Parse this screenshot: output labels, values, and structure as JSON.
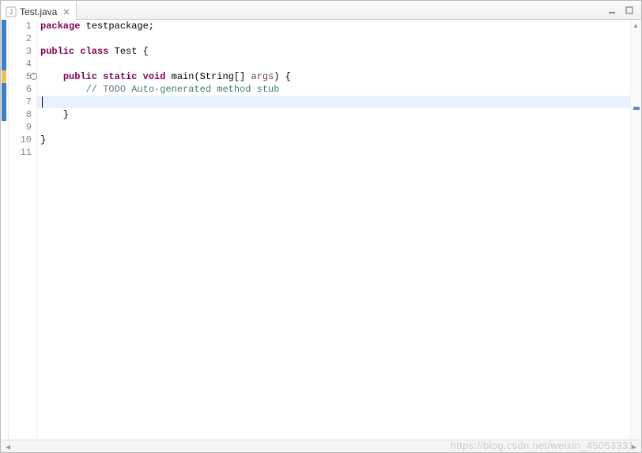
{
  "tab": {
    "title": "Test.java",
    "close_icon": "close"
  },
  "gutter": {
    "lines": [
      "1",
      "2",
      "3",
      "4",
      "5",
      "6",
      "7",
      "8",
      "9",
      "10",
      "11"
    ]
  },
  "code": {
    "lines": [
      [
        {
          "t": "package",
          "c": "kw"
        },
        {
          "t": " testpackage;",
          "c": "plain"
        }
      ],
      [],
      [
        {
          "t": "public class",
          "c": "kw"
        },
        {
          "t": " Test {",
          "c": "plain"
        }
      ],
      [],
      [
        {
          "t": "    ",
          "c": "plain"
        },
        {
          "t": "public static void",
          "c": "kw"
        },
        {
          "t": " main(String[] ",
          "c": "plain"
        },
        {
          "t": "args",
          "c": "args"
        },
        {
          "t": ") {",
          "c": "plain"
        }
      ],
      [
        {
          "t": "        ",
          "c": "plain"
        },
        {
          "t": "// ",
          "c": "cmt"
        },
        {
          "t": "TODO",
          "c": "str"
        },
        {
          "t": " Auto-generated method stub",
          "c": "cmt"
        }
      ],
      [],
      [
        {
          "t": "    }",
          "c": "plain"
        }
      ],
      [],
      [
        {
          "t": "}",
          "c": "plain"
        }
      ],
      []
    ],
    "highlight_line": 7
  },
  "markers": {
    "blue_lines": [
      1,
      2,
      3,
      4,
      5,
      6,
      7,
      8
    ],
    "yellow_lines": [
      5
    ]
  },
  "watermark": "https://blog.csdn.net/weixin_45053331"
}
